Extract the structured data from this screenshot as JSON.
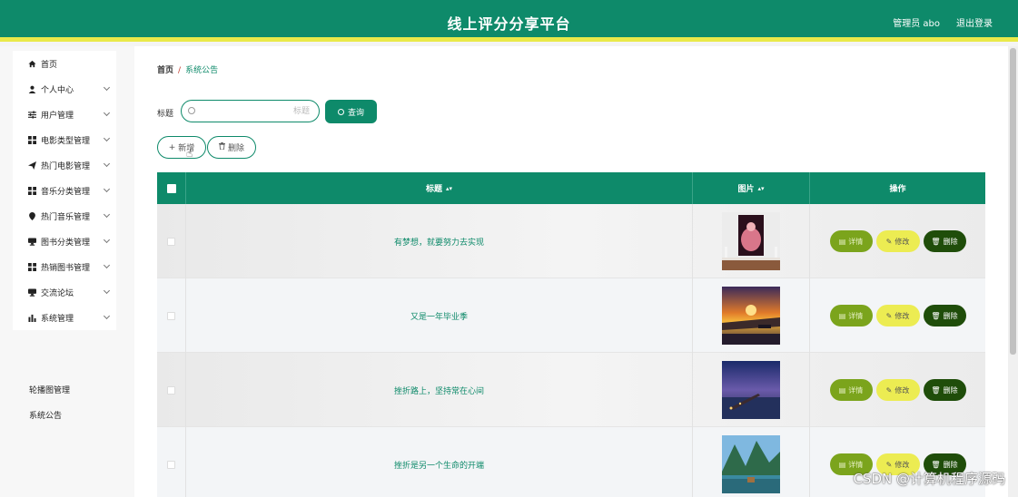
{
  "header": {
    "title": "线上评分分享平台",
    "user": "管理员 abo",
    "logout": "退出登录",
    "bg_color": "#0e8a6a",
    "accent_color": "#e9e94a"
  },
  "sidebar": {
    "items": [
      {
        "label": "首页",
        "icon": "home-icon",
        "has_children": false
      },
      {
        "label": "个人中心",
        "icon": "user-icon",
        "has_children": true
      },
      {
        "label": "用户管理",
        "icon": "sliders-icon",
        "has_children": true
      },
      {
        "label": "电影类型管理",
        "icon": "grid-icon",
        "has_children": true
      },
      {
        "label": "热门电影管理",
        "icon": "send-icon",
        "has_children": true
      },
      {
        "label": "音乐分类管理",
        "icon": "grid-icon",
        "has_children": true
      },
      {
        "label": "热门音乐管理",
        "icon": "pin-icon",
        "has_children": true
      },
      {
        "label": "图书分类管理",
        "icon": "monitor-icon",
        "has_children": true
      },
      {
        "label": "热销图书管理",
        "icon": "grid-icon",
        "has_children": true
      },
      {
        "label": "交流论坛",
        "icon": "monitor-icon",
        "has_children": true
      },
      {
        "label": "系统管理",
        "icon": "bar-chart-icon",
        "has_children": true
      }
    ],
    "sub_items": [
      "轮播图管理",
      "系统公告"
    ]
  },
  "breadcrumb": {
    "home": "首页",
    "separator": "/",
    "current": "系统公告"
  },
  "search": {
    "label": "标题",
    "placeholder": "标题",
    "value": "",
    "button": "查询"
  },
  "actions": {
    "add": "新增",
    "delete": "删除"
  },
  "table": {
    "columns": {
      "title": "标题",
      "image": "图片",
      "operation": "操作"
    },
    "rows": [
      {
        "title": "有梦想，就要努力去实现",
        "image": "poster-art"
      },
      {
        "title": "又是一年毕业季",
        "image": "sunset-pier"
      },
      {
        "title": "挫折路上，坚持常在心间",
        "image": "night-pier"
      },
      {
        "title": "挫折是另一个生命的开端",
        "image": "mountain-lake"
      }
    ],
    "row_actions": {
      "detail": "详情",
      "edit": "修改",
      "delete": "删除"
    }
  },
  "watermark": "CSDN @计算机程序源码"
}
